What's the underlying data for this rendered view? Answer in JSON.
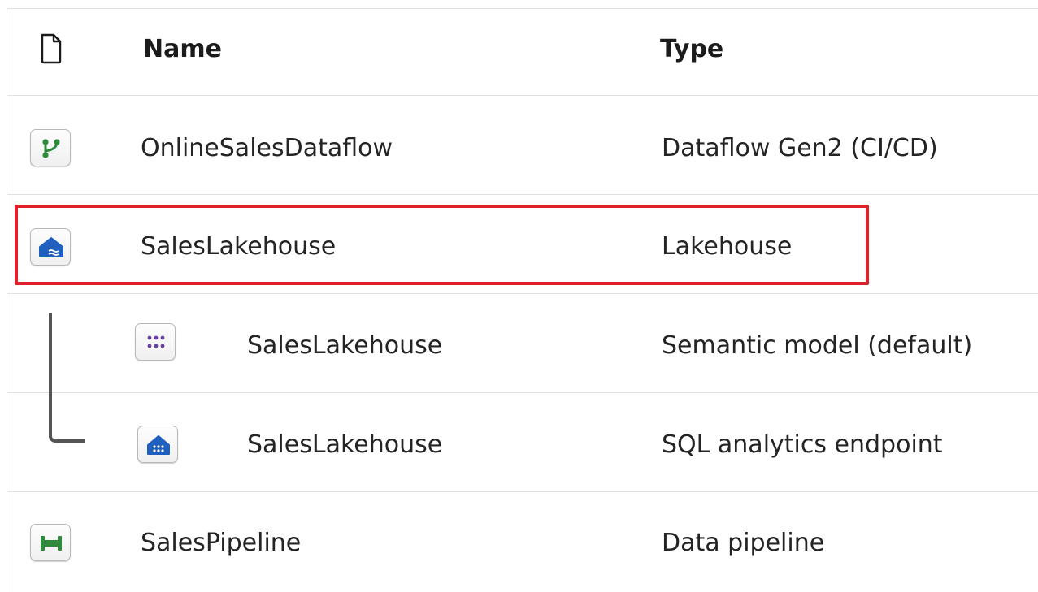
{
  "table": {
    "header": {
      "icon": "document-icon",
      "name_label": "Name",
      "type_label": "Type"
    },
    "rows": [
      {
        "icon": "dataflow-icon",
        "name": "OnlineSalesDataflow",
        "type": "Dataflow Gen2 (CI/CD)",
        "indent": false,
        "highlighted": false
      },
      {
        "icon": "lakehouse-icon",
        "name": "SalesLakehouse",
        "type": "Lakehouse",
        "indent": false,
        "highlighted": true
      },
      {
        "icon": "semantic-model-icon",
        "name": "SalesLakehouse",
        "type": "Semantic model (default)",
        "indent": true,
        "highlighted": false
      },
      {
        "icon": "sql-endpoint-icon",
        "name": "SalesLakehouse",
        "type": "SQL analytics endpoint",
        "indent": true,
        "highlighted": false
      },
      {
        "icon": "pipeline-icon",
        "name": "SalesPipeline",
        "type": "Data pipeline",
        "indent": false,
        "highlighted": false
      }
    ]
  },
  "colors": {
    "highlight": "#e0202a",
    "dataflow_green": "#2e8b3c",
    "lakehouse_blue": "#1f5fbf",
    "semantic_purple": "#6b3fa0",
    "pipeline_green": "#2e8b3c"
  }
}
